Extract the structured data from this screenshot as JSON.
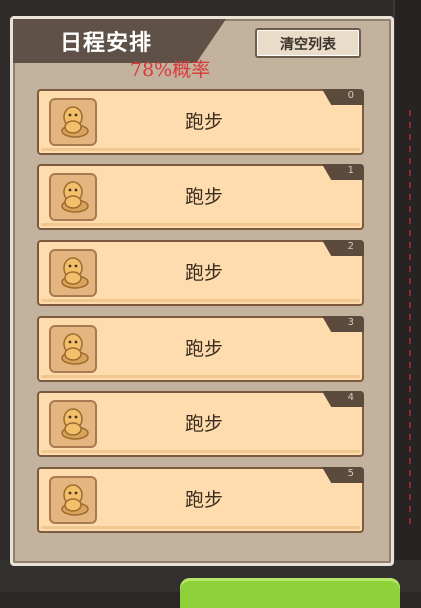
{
  "header": {
    "title": "日程安排",
    "probability": "78%概率",
    "clear_button": "清空列表"
  },
  "schedule": {
    "items": [
      {
        "index": "0",
        "label": "跑步",
        "icon": "peanut-character-icon"
      },
      {
        "index": "1",
        "label": "跑步",
        "icon": "peanut-character-icon"
      },
      {
        "index": "2",
        "label": "跑步",
        "icon": "peanut-character-icon"
      },
      {
        "index": "3",
        "label": "跑步",
        "icon": "peanut-character-icon"
      },
      {
        "index": "4",
        "label": "跑步",
        "icon": "peanut-character-icon"
      },
      {
        "index": "5",
        "label": "跑步",
        "icon": "peanut-character-icon"
      }
    ]
  },
  "colors": {
    "panel_bg": "#c2b29e",
    "item_bg": "#ffdcae",
    "probability_text": "#d83a3a",
    "confirm_button": "#8fd13b"
  }
}
